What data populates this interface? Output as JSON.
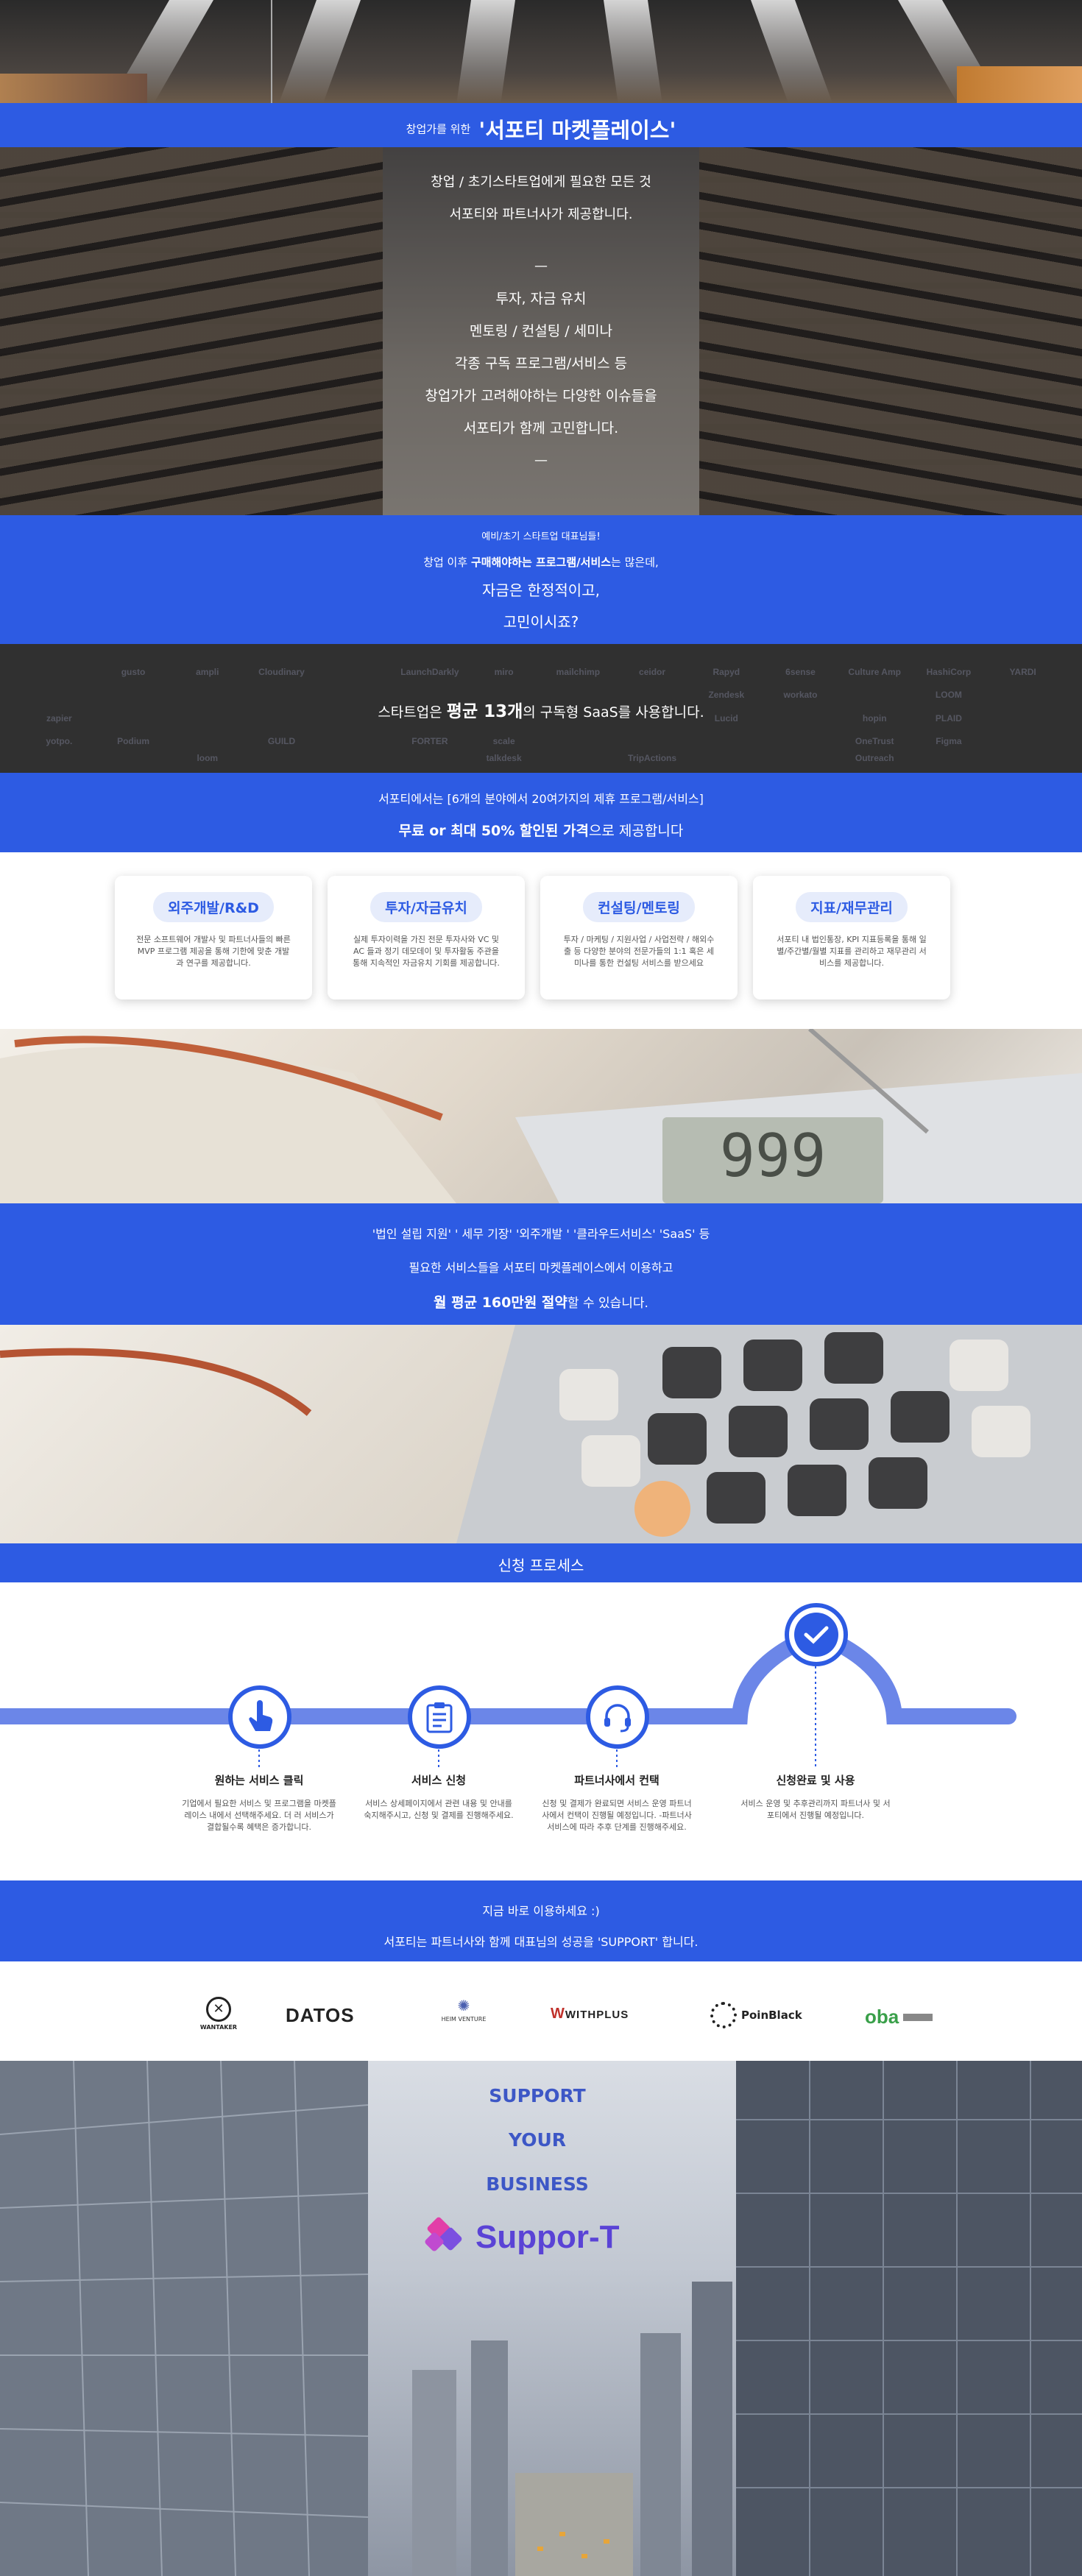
{
  "hero": {
    "title_prefix": "창업가를 위한",
    "title_main": "'서포티 마켓플레이스'",
    "intro_line1": "창업 / 초기스타트업에게 필요한 모든 것",
    "intro_line2": "서포티와 파트너사가 제공합니다.",
    "dash": "—",
    "issues": [
      "투자, 자금 유치",
      "멘토링 / 컨설팅 / 세미나",
      "각종 구독 프로그램/서비스 등",
      "창업가가 고려해야하는 다양한 이슈들을",
      "서포티가 함께 고민합니다."
    ]
  },
  "concern": {
    "small": "예비/초기 스타트업 대표님들!",
    "line1_a": "창업 이후 ",
    "line1_b": "구매해야하는 프로그램/서비스",
    "line1_c": "는 많은데,",
    "line2": "자금은 한정적이고,",
    "line3": "고민이시죠?"
  },
  "saas": {
    "text_a": "스타트업은 ",
    "text_b": "평균 13개",
    "text_c": "의 구독형 SaaS를 사용합니다.",
    "logos": [
      "",
      "gusto",
      "ampli",
      "Cloudinary",
      "",
      "LaunchDarkly",
      "miro",
      "mailchimp",
      "ceidor",
      "Rapyd",
      "6sense",
      "Culture Amp",
      "HashiCorp",
      "YARDI",
      "",
      "",
      "",
      "",
      "",
      "",
      "",
      "",
      "",
      "Zendesk",
      "workato",
      "",
      "LOOM",
      "",
      "zapier",
      "",
      "",
      "",
      "",
      "",
      "",
      "",
      "",
      "Lucid",
      "",
      "hopin",
      "PLAID",
      "",
      "yotpo.",
      "Podium",
      "",
      "GUILD",
      "",
      "FORTER",
      "scale",
      "",
      "",
      "",
      "",
      "OneTrust",
      "Figma",
      "",
      "",
      "",
      "loom",
      "",
      "",
      "",
      "talkdesk",
      "",
      "TripActions",
      "",
      "",
      "Outreach"
    ]
  },
  "offer": {
    "line1": "서포티에서는 [6개의 분야에서 20여가지의 제휴 프로그램/서비스]",
    "line2_a": "무료 or 최대 50% 할인된 가격",
    "line2_b": "으로 제공합니다"
  },
  "categories": [
    {
      "title": "외주개발/R&D",
      "desc": "전문 소프트웨어 개발사 및 파트너사들의 빠른 MVP 프로그램 제공을 통해 기한에 맞춘 개발과 연구를 제공합니다."
    },
    {
      "title": "투자/자금유치",
      "desc": "실제 투자이력을 가진 전문 투자사와 VC 및 AC 들과 정기 데모데이 및 투자활동 주관을 통해 지속적인 자금유치 기회를 제공합니다."
    },
    {
      "title": "컨설팅/멘토링",
      "desc": "투자 / 마케팅 / 지원사업 / 사업전략 / 해외수출 등 다양한 분야의 전문가들의 1:1 혹은 세미나를 통한 컨설팅 서비스를 받으세요"
    },
    {
      "title": "지표/재무관리",
      "desc": "서포티 내 법인통장, KPI 지표등록을 통해 일별/주간별/월별 지표를 관리하고 재무관리 서비스를 제공합니다."
    }
  ],
  "savings": {
    "line1": "'법인 설립 지원' ' 세무 기장' '외주개발 ' '클라우드서비스' 'SaaS' 등",
    "line2": "필요한 서비스들을 서포티 마켓플레이스에서 이용하고",
    "line3_a": "월 평균 160만원 절약",
    "line3_b": "할 수 있습니다.",
    "calc_display": "999"
  },
  "process": {
    "heading": "신청 프로세스",
    "steps": [
      {
        "icon": "hand-click-icon",
        "title": "원하는 서비스 클릭",
        "desc": "기업에서 필요한 서비스 및 프로그램을 마켓플레이스 내에서 선택해주세요. 더 러 서비스가 결합될수록 혜택은 증가합니다."
      },
      {
        "icon": "clipboard-icon",
        "title": "서비스 신청",
        "desc": "서비스 상세페이지에서 관련 내용 및 안내를 숙지해주시고, 신청 및 결제를 진행해주세요."
      },
      {
        "icon": "headset-icon",
        "title": "파트너사에서 컨택",
        "desc": "신청 및 결제가 완료되면 서비스 운영 파트너사에서 컨택이 진행될 예정입니다. -파트너사 서비스에 따라 추후 단계를 진행해주세요."
      },
      {
        "icon": "check-icon",
        "title": "신청완료 및 사용",
        "desc": "서비스 운영 및 추후관리까지 파트너사 및 서포티에서 진행될 예정입니다."
      }
    ]
  },
  "cta": {
    "line1": "지금 바로 이용하세요 :)",
    "line2": "서포티는 파트너사와 함께 대표님의 성공을 'SUPPORT' 합니다."
  },
  "partners": [
    "WANTAKER",
    "DATOS",
    "HEIM VENTURE",
    "WITHPLUS",
    "PoinBlack",
    "oba"
  ],
  "closing": {
    "words": [
      "SUPPORT",
      "YOUR",
      "BUSINESS"
    ],
    "brand": "Suppor-T"
  },
  "colors": {
    "brand_blue": "#2d5be3",
    "pill_bg": "#e6ecfb",
    "process_line": "#6b86e8"
  }
}
